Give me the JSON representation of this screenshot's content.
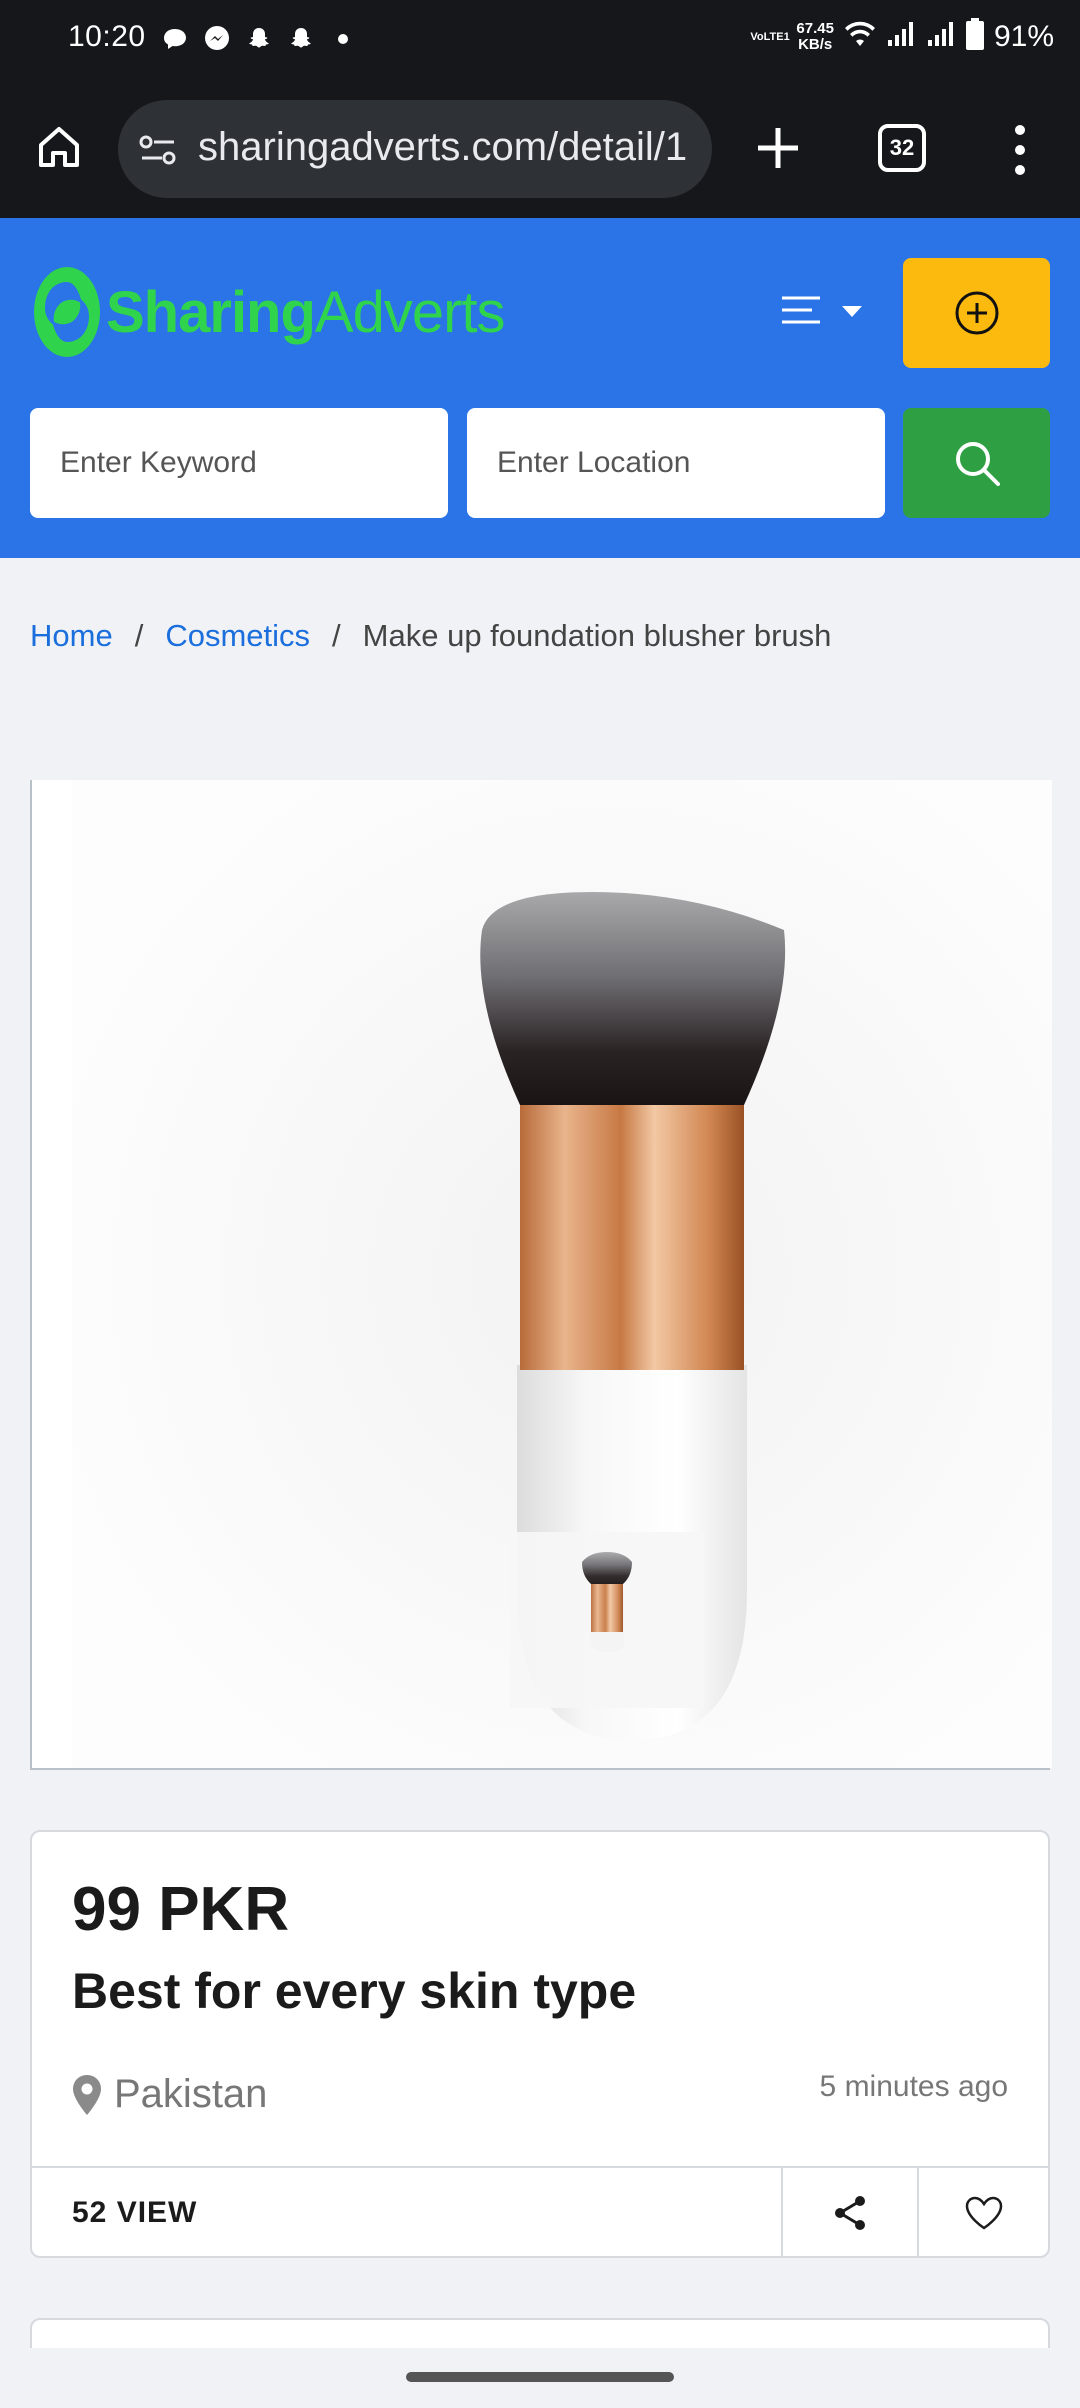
{
  "status_bar": {
    "time": "10:20",
    "network_label": "VoLTE1",
    "speed_value": "67.45",
    "speed_unit": "KB/s",
    "battery": "91%"
  },
  "browser": {
    "url": "sharingadverts.com/detail/1",
    "tab_count": "32"
  },
  "header": {
    "logo_part1": "Sharing",
    "logo_part2": "Adverts",
    "brand_color": "#2b74e8",
    "post_button_color": "#fdba0e",
    "search_button_color": "#2ea043"
  },
  "search": {
    "keyword_placeholder": "Enter Keyword",
    "location_placeholder": "Enter Location"
  },
  "breadcrumb": {
    "home": "Home",
    "category": "Cosmetics",
    "current": "Make up foundation blusher brush",
    "separator": "/"
  },
  "listing": {
    "price": "99 PKR",
    "title": "Best for every skin type",
    "location": "Pakistan",
    "posted": "5 minutes ago",
    "views": "52 VIEW"
  }
}
